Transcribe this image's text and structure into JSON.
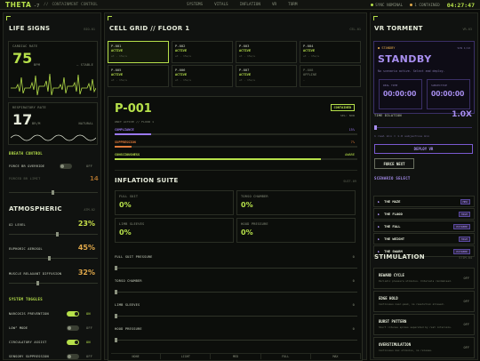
{
  "topbar": {
    "logo": "THETA",
    "logo_sup": "-7",
    "logo_mark": "//",
    "subtitle": "CONTAINMENT CONTROL",
    "nav": [
      "SYSTEMS",
      "VITALS",
      "INFLATION",
      "VR",
      "TORM"
    ],
    "status1": "SYNC NOMINAL",
    "status2": "1 CONTAINED",
    "clock": "04:27:47"
  },
  "life": {
    "title": "LIFE SIGNS",
    "tag": "BIO-01",
    "cardiac_label": "CARDIAC RATE",
    "cardiac_value": "75",
    "cardiac_unit": "BPM",
    "cardiac_state": "— STABLE",
    "resp_label": "RESPIRATORY RATE",
    "resp_value": "17",
    "resp_unit": "BR/M",
    "resp_state": "NATURAL"
  },
  "breath": {
    "title": "BREATH CONTROL",
    "override_label": "FORCE BR OVERRIDE",
    "override_state": "OFF",
    "forced_label": "FORCED BR LIMIT",
    "forced_value": "14"
  },
  "atmo": {
    "title": "ATMOSPHERIC",
    "tag": "ATM-02",
    "items": [
      {
        "label": "O2 LEVEL",
        "value": "23%",
        "color": "#c8e04a",
        "frac": 0.55
      },
      {
        "label": "EUPHORIC AEROSOL",
        "value": "45%",
        "color": "#e0a84a",
        "frac": 0.45
      },
      {
        "label": "MUSCLE RELAXANT DIFFUSION",
        "value": "32%",
        "color": "#e0a84a",
        "frac": 0.32
      }
    ]
  },
  "toggles": {
    "title": "SYSTEM TOGGLES",
    "items": [
      {
        "label": "NARCOSIS PREVENTION",
        "state": "ON",
        "on": true
      },
      {
        "label": "LOW² MODE",
        "state": "OFF",
        "on": false
      },
      {
        "label": "CIRCULATORY ASSIST",
        "state": "ON",
        "on": true
      },
      {
        "label": "SENSORY SUPPRESSION",
        "state": "OFF",
        "on": false
      }
    ]
  },
  "grid": {
    "title": "CELL GRID // FLOOR 1",
    "tag": "CEL-01",
    "cells": [
      {
        "id": "P-001",
        "status": "ACTIVE",
        "sub": "wt · 15s/s",
        "active": true
      },
      {
        "id": "P-002",
        "status": "ACTIVE",
        "sub": "wt · 15s/s",
        "active": true
      },
      {
        "id": "P-003",
        "status": "ACTIVE",
        "sub": "wt · 15s/s",
        "active": true
      },
      {
        "id": "P-004",
        "status": "ACTIVE",
        "sub": "wt · 15s/s",
        "active": true
      },
      {
        "id": "P-005",
        "status": "ACTIVE",
        "sub": "wt · 15s/s",
        "active": true
      },
      {
        "id": "P-006",
        "status": "ACTIVE",
        "sub": "wt · 15s/s",
        "active": true
      },
      {
        "id": "P-007",
        "status": "ACTIVE",
        "sub": "wt · 15s/s",
        "active": true
      },
      {
        "id": "P-008",
        "status": "OFFLINE",
        "sub": "—",
        "active": false
      }
    ]
  },
  "detail": {
    "id": "P-001",
    "badge": "CONTAINED",
    "sub": "UNIT ACTIVE // FLOOR 1",
    "sub_right": "SEL: NOW",
    "bars": [
      {
        "label": "COMPLIANCE",
        "value": "15%",
        "color": "#9a78f0",
        "frac": 0.15
      },
      {
        "label": "SUPPRESSION",
        "value": "7%",
        "color": "#e07a3a",
        "frac": 0.07
      },
      {
        "label": "CONSCIOUSNESS",
        "value": "AWARE",
        "color": "#b6e04a",
        "frac": 0.85
      }
    ]
  },
  "inflation": {
    "title": "INFLATION SUITE",
    "tag": "SUIT-09",
    "cards": [
      {
        "label": "FULL SUIT",
        "value": "0%"
      },
      {
        "label": "TORSO CHAMBER",
        "value": "0%"
      },
      {
        "label": "LIMB SLEEVES",
        "value": "0%"
      },
      {
        "label": "HOOD PRESSURE",
        "value": "0%"
      }
    ],
    "sliders": [
      {
        "label": "FULL SUIT PRESSURE",
        "value": "0"
      },
      {
        "label": "TORSO CHAMBER",
        "value": "0"
      },
      {
        "label": "LIMB SLEEVES",
        "value": "0"
      },
      {
        "label": "HOOD PRESSURE",
        "value": "0"
      }
    ],
    "presets": [
      "NONE",
      "LIGHT",
      "MED",
      "FULL",
      "MAX"
    ]
  },
  "vr": {
    "title": "VR TORMENT",
    "tag": "VR-03",
    "standby_label": "● STANDBY",
    "standby_tag": "SCN 1/12",
    "standby_value": "STANDBY",
    "note": "No scenario active. Select and deploy.",
    "real_label": "REAL TIME",
    "real_value": "00:00:00",
    "subj_label": "SUBJECTIVE",
    "subj_value": "00:00:00",
    "dil_label": "TIME DILATION",
    "dil_value": "1.0X",
    "dil_note": "1 real min = 1.0 subjective min",
    "deploy": "DEPLOY VR",
    "force": "FORCE NEXT",
    "scen_title": "SCENARIO SELECT",
    "scenarios": [
      {
        "label": "THE MAZE",
        "diff": "MED"
      },
      {
        "label": "THE FLOOD",
        "diff": "HIGH"
      },
      {
        "label": "THE FALL",
        "diff": "EXTREME"
      },
      {
        "label": "THE WEIGHT",
        "diff": "HIGH"
      },
      {
        "label": "THE SWARM",
        "diff": "EXTREME"
      }
    ]
  },
  "stim": {
    "title": "STIMULATION",
    "tag": "STIM-04",
    "items": [
      {
        "title": "REWARD CYCLE",
        "desc": "Periodic pleasure stimulus. Intervals randomised.",
        "state": "OFF"
      },
      {
        "title": "EDGE HOLD",
        "desc": "Continuous near-peak, no resolution allowed.",
        "state": "OFF"
      },
      {
        "title": "BURST PATTERN",
        "desc": "Short intense spikes separated by rest intervals.",
        "state": "OFF"
      },
      {
        "title": "OVERSTIMULATION",
        "desc": "Continuous max stimulus, no release.",
        "state": "OFF"
      }
    ]
  }
}
